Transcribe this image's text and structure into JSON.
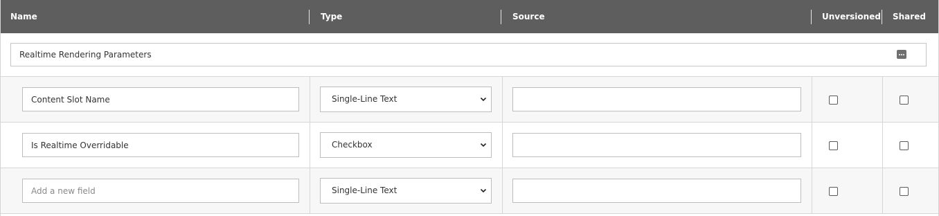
{
  "header": {
    "name": "Name",
    "type": "Type",
    "source": "Source",
    "unversioned": "Unversioned",
    "shared": "Shared"
  },
  "section": {
    "title": "Realtime Rendering Parameters"
  },
  "rows": [
    {
      "name": "Content Slot Name",
      "type": "Single-Line Text",
      "source": "",
      "unversioned": false,
      "shared": false
    },
    {
      "name": "Is Realtime Overridable",
      "type": "Checkbox",
      "source": "",
      "unversioned": false,
      "shared": false
    }
  ],
  "new_field": {
    "placeholder": "Add a new field",
    "type": "Single-Line Text",
    "source": ""
  },
  "icons": {
    "more": "more-options-icon",
    "dropdown": "chevron-down-icon"
  },
  "colors": {
    "header_bg": "#5e5e5e",
    "header_text": "#ffffff",
    "row_bg": "#f7f7f7"
  }
}
